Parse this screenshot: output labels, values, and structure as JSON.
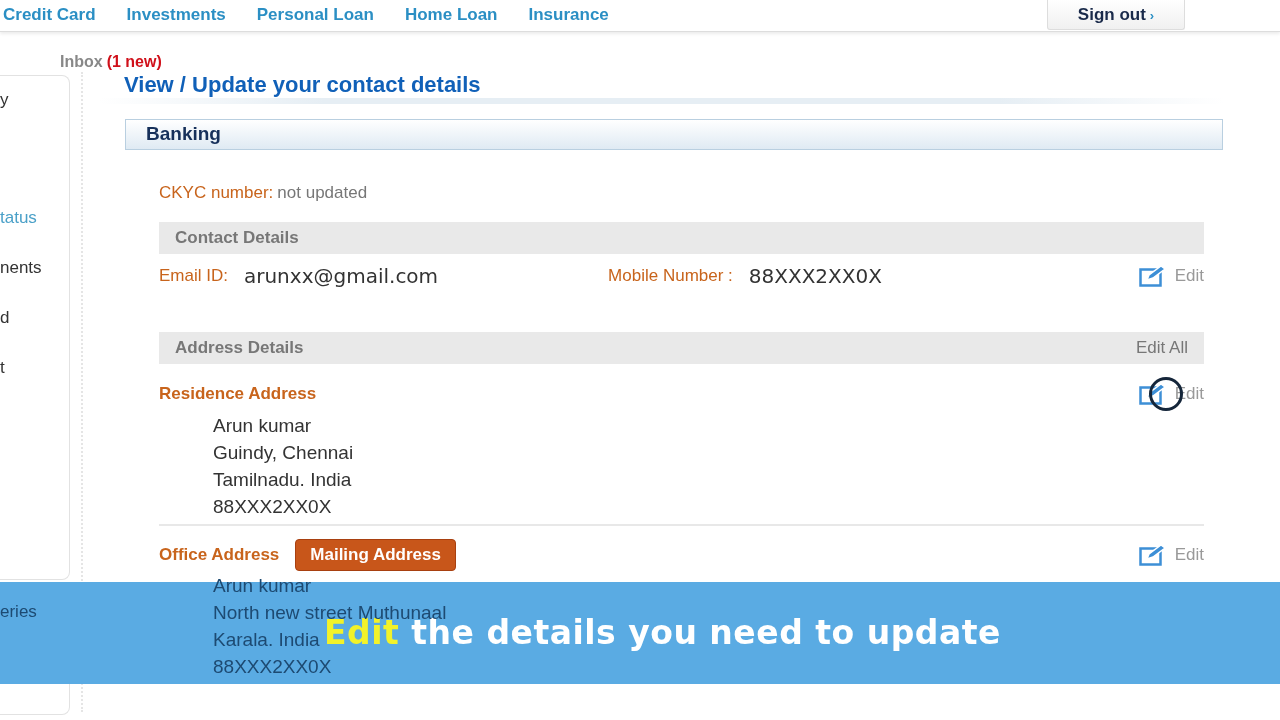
{
  "nav": {
    "links": [
      "Credit Card",
      "Investments",
      "Personal Loan",
      "Home Loan",
      "Insurance"
    ],
    "sign_out": "Sign out",
    "sign_out_arrow": "›"
  },
  "inbox": {
    "label": "Inbox",
    "count": "(1 new)"
  },
  "sidebar": {
    "items": [
      {
        "label": "y",
        "selected": false
      },
      {
        "label": "tatus",
        "selected": true
      },
      {
        "label": "nents",
        "selected": false
      },
      {
        "label": "d",
        "selected": false
      },
      {
        "label": "t",
        "selected": false
      }
    ],
    "lower_items": [
      {
        "label": "eries"
      }
    ]
  },
  "page_title": "View / Update your contact details",
  "section": "Banking",
  "ckyc": {
    "label": "CKYC number:",
    "value": "not updated"
  },
  "contact": {
    "heading": "Contact Details",
    "fields": [
      {
        "label": "Email ID:",
        "value": "arunxx@gmail.com"
      },
      {
        "label": "Mobile Number :",
        "value": "88XXX2XX0X"
      }
    ],
    "edit": "Edit"
  },
  "address": {
    "heading": "Address Details",
    "edit_all": "Edit All",
    "entries": [
      {
        "title": "Residence Address",
        "lines": [
          "Arun kumar",
          "Guindy, Chennai",
          "Tamilnadu. India",
          "88XXX2XX0X"
        ],
        "edit": "Edit",
        "cursor": true
      },
      {
        "title": "Office Address",
        "badge": "Mailing Address",
        "lines": [
          "Arun kumar",
          "North new street Muthunaal",
          "Karala. India",
          "88XXX2XX0X"
        ],
        "edit": "Edit",
        "cursor": false
      }
    ]
  },
  "caption": {
    "highlight": "Edit",
    "text": "the details you need to update"
  }
}
